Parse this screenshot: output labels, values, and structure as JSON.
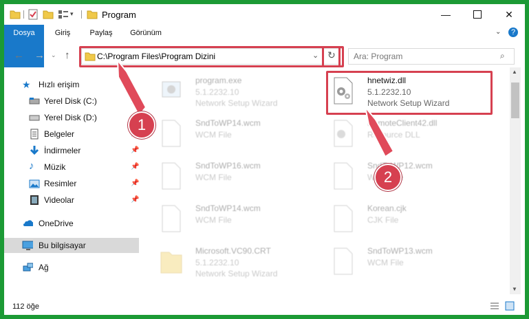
{
  "window": {
    "title": "Program"
  },
  "ribbon": {
    "tabs": [
      "Dosya",
      "Giriş",
      "Paylaş",
      "Görünüm"
    ]
  },
  "address": {
    "path": "C:\\Program Files\\Program Dizini"
  },
  "search": {
    "placeholder": "Ara: Program"
  },
  "sidebar": {
    "items": [
      {
        "label": "Hızlı erişim",
        "icon": "star-icon"
      },
      {
        "label": "Yerel Disk (C:)",
        "icon": "drive-icon"
      },
      {
        "label": "Yerel Disk (D:)",
        "icon": "drive-icon"
      },
      {
        "label": "Belgeler",
        "icon": "documents-icon"
      },
      {
        "label": "İndirmeler",
        "icon": "download-icon"
      },
      {
        "label": "Müzik",
        "icon": "music-icon"
      },
      {
        "label": "Resimler",
        "icon": "pictures-icon"
      },
      {
        "label": "Videolar",
        "icon": "video-icon"
      },
      {
        "label": "OneDrive",
        "icon": "cloud-icon"
      },
      {
        "label": "Bu bilgisayar",
        "icon": "computer-icon"
      },
      {
        "label": "Ağ",
        "icon": "network-icon"
      }
    ]
  },
  "files": [
    {
      "name": "program.exe",
      "line2": "5.1.2232.10",
      "line3": "Network Setup Wizard"
    },
    {
      "name": "hnetwiz.dll",
      "line2": "5.1.2232.10",
      "line3": "Network Setup Wizard"
    },
    {
      "name": "SndToWP14.wcm",
      "line2": "WCM File",
      "line3": ""
    },
    {
      "name": "RemoteClient42.dll",
      "line2": "Resource DLL",
      "line3": ""
    },
    {
      "name": "SndToWP16.wcm",
      "line2": "WCM File",
      "line3": ""
    },
    {
      "name": "SndToWP12.wcm",
      "line2": "WCM File",
      "line3": ""
    },
    {
      "name": "SndToWP14.wcm",
      "line2": "WCM File",
      "line3": ""
    },
    {
      "name": "Korean.cjk",
      "line2": "CJK File",
      "line3": ""
    },
    {
      "name": "Microsoft.VC90.CRT",
      "line2": "5.1.2232.10",
      "line3": "Network Setup Wizard"
    },
    {
      "name": "SndToWP13.wcm",
      "line2": "WCM File",
      "line3": ""
    }
  ],
  "status": {
    "count": "112 öğe"
  },
  "annotations": {
    "badge1": "1",
    "badge2": "2"
  },
  "colors": {
    "accent": "#1979ca",
    "highlight": "#d64050",
    "background": "#1c9a35"
  }
}
